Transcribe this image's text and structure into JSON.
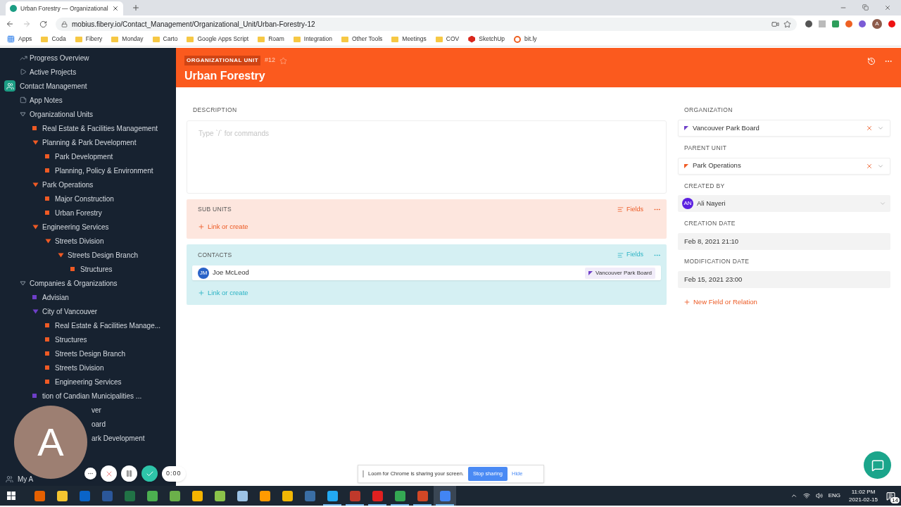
{
  "browser": {
    "tab_title": "Urban Forestry — Organizational",
    "url": "mobius.fibery.io/Contact_Management/Organizational_Unit/Urban-Forestry-12",
    "profile_initial": "A",
    "bookmarks": [
      {
        "label": "Apps",
        "kind": "apps"
      },
      {
        "label": "Coda",
        "kind": "folder"
      },
      {
        "label": "Fibery",
        "kind": "folder"
      },
      {
        "label": "Monday",
        "kind": "folder"
      },
      {
        "label": "Carto",
        "kind": "folder"
      },
      {
        "label": "Google Apps Script",
        "kind": "folder"
      },
      {
        "label": "Roam",
        "kind": "folder"
      },
      {
        "label": "Integration",
        "kind": "folder"
      },
      {
        "label": "Other Tools",
        "kind": "folder"
      },
      {
        "label": "Meetings",
        "kind": "folder"
      },
      {
        "label": "COV",
        "kind": "folder"
      },
      {
        "label": "SketchUp",
        "kind": "sketchup"
      },
      {
        "label": "bit.ly",
        "kind": "bitly"
      }
    ]
  },
  "sidebar": {
    "items": [
      {
        "label": "Progress Overview",
        "kind": "chart"
      },
      {
        "label": "Active Projects",
        "kind": "board"
      },
      {
        "label": "Contact Management",
        "kind": "app"
      },
      {
        "label": "App Notes",
        "kind": "notes"
      },
      {
        "label": "Organizational Units",
        "kind": "type",
        "expanded": true,
        "children": [
          {
            "label": "Real Estate & Facilities Management",
            "kind": "entity",
            "color": "#f05a24"
          },
          {
            "label": "Planning & Park Development",
            "kind": "entity",
            "color": "#f05a24",
            "expanded": true,
            "children": [
              {
                "label": "Park Development",
                "kind": "entity",
                "color": "#f05a24"
              },
              {
                "label": "Planning, Policy & Environment",
                "kind": "entity",
                "color": "#f05a24"
              }
            ]
          },
          {
            "label": "Park Operations",
            "kind": "entity",
            "color": "#f05a24",
            "expanded": true,
            "children": [
              {
                "label": "Major Construction",
                "kind": "entity",
                "color": "#f05a24"
              },
              {
                "label": "Urban Forestry",
                "kind": "entity",
                "color": "#f05a24"
              }
            ]
          },
          {
            "label": "Engineering Services",
            "kind": "entity",
            "color": "#f05a24",
            "expanded": true,
            "children": [
              {
                "label": "Streets Division",
                "kind": "entity",
                "color": "#f05a24",
                "expanded": true,
                "children": [
                  {
                    "label": "Streets Design Branch",
                    "kind": "entity",
                    "color": "#f05a24",
                    "expanded": true,
                    "children": [
                      {
                        "label": "Structures",
                        "kind": "entity",
                        "color": "#f05a24"
                      }
                    ]
                  }
                ]
              }
            ]
          }
        ]
      },
      {
        "label": "Companies & Organizations",
        "kind": "type",
        "expanded": true,
        "children": [
          {
            "label": "Advisian",
            "kind": "entity",
            "color": "#6e3fc8"
          },
          {
            "label": "City of Vancouver",
            "kind": "entity",
            "color": "#6e3fc8",
            "expanded": true,
            "children": [
              {
                "label": "Real Estate & Facilities Manage...",
                "kind": "entity",
                "color": "#f05a24"
              },
              {
                "label": "Structures",
                "kind": "entity",
                "color": "#f05a24"
              },
              {
                "label": "Streets Design Branch",
                "kind": "entity",
                "color": "#f05a24"
              },
              {
                "label": "Streets Division",
                "kind": "entity",
                "color": "#f05a24"
              },
              {
                "label": "Engineering Services",
                "kind": "entity",
                "color": "#f05a24"
              }
            ]
          },
          {
            "label": "tion of Candian Municipalities ...",
            "kind": "entity",
            "color": "#6e3fc8"
          },
          {
            "label": "ver",
            "kind": "partial"
          },
          {
            "label": "oard",
            "kind": "partial"
          },
          {
            "label": "ark Development",
            "kind": "partial"
          }
        ]
      }
    ],
    "footer": "My A"
  },
  "entity": {
    "type_badge": "ORGANIZATIONAL UNIT",
    "number": "#12",
    "starred": false,
    "title": "Urban Forestry"
  },
  "description": {
    "label": "DESCRIPTION",
    "placeholder": "Type `/` for commands"
  },
  "collections": [
    {
      "title": "SUB UNITS",
      "kind": "orange",
      "fields_label": "Fields",
      "link_label": "Link or create"
    },
    {
      "title": "CONTACTS",
      "kind": "teal",
      "fields_label": "Fields",
      "link_label": "Link or create",
      "items": [
        {
          "name": "Joe McLeod",
          "initials": "JM",
          "tag": "Vancouver Park Board"
        }
      ]
    }
  ],
  "fields": [
    {
      "label": "ORGANIZATION",
      "kind": "relation",
      "value": "Vancouver Park Board",
      "color": "#6e3fc8"
    },
    {
      "label": "PARENT UNIT",
      "kind": "relation",
      "value": "Park Operations",
      "color": "#f05a24"
    },
    {
      "label": "CREATED BY",
      "kind": "user",
      "value": "Ali Nayeri",
      "initials": "AN"
    },
    {
      "label": "CREATION DATE",
      "kind": "date",
      "value": "Feb 8, 2021 21:10"
    },
    {
      "label": "MODIFICATION DATE",
      "kind": "date",
      "value": "Feb 15, 2021 23:00"
    }
  ],
  "new_field_label": "New Field or Relation",
  "loom": {
    "avatar_initial": "A",
    "timer": "0:00",
    "banner": "Loom for Chrome is sharing your screen.",
    "stop_label": "Stop sharing",
    "hide_label": "Hide"
  },
  "taskbar": {
    "apps": [
      {
        "color": "#e66000",
        "open": false,
        "selected": false
      },
      {
        "color": "#f4c430",
        "open": false,
        "selected": false
      },
      {
        "color": "#0a64c8",
        "open": false,
        "selected": false
      },
      {
        "color": "#2b579a",
        "open": false,
        "selected": false
      },
      {
        "color": "#217346",
        "open": false,
        "selected": false
      },
      {
        "color": "#4caf50",
        "open": false,
        "selected": false
      },
      {
        "color": "#6bb04a",
        "open": false,
        "selected": false
      },
      {
        "color": "#f5b400",
        "open": false,
        "selected": false
      },
      {
        "color": "#8bc34a",
        "open": false,
        "selected": false
      },
      {
        "color": "#9cc3e6",
        "open": false,
        "selected": false
      },
      {
        "color": "#ff9a00",
        "open": false,
        "selected": false
      },
      {
        "color": "#f2b705",
        "open": false,
        "selected": false
      },
      {
        "color": "#3a6ea5",
        "open": false,
        "selected": false
      },
      {
        "color": "#23a9f2",
        "open": true,
        "selected": false
      },
      {
        "color": "#c0392b",
        "open": true,
        "selected": false
      },
      {
        "color": "#e02020",
        "open": true,
        "selected": false
      },
      {
        "color": "#34a853",
        "open": true,
        "selected": false
      },
      {
        "color": "#d24726",
        "open": true,
        "selected": false
      },
      {
        "color": "#4285f4",
        "open": true,
        "selected": true
      }
    ],
    "language": "ENG",
    "time": "11:02 PM",
    "date": "2021-02-15",
    "notifications": "14"
  }
}
